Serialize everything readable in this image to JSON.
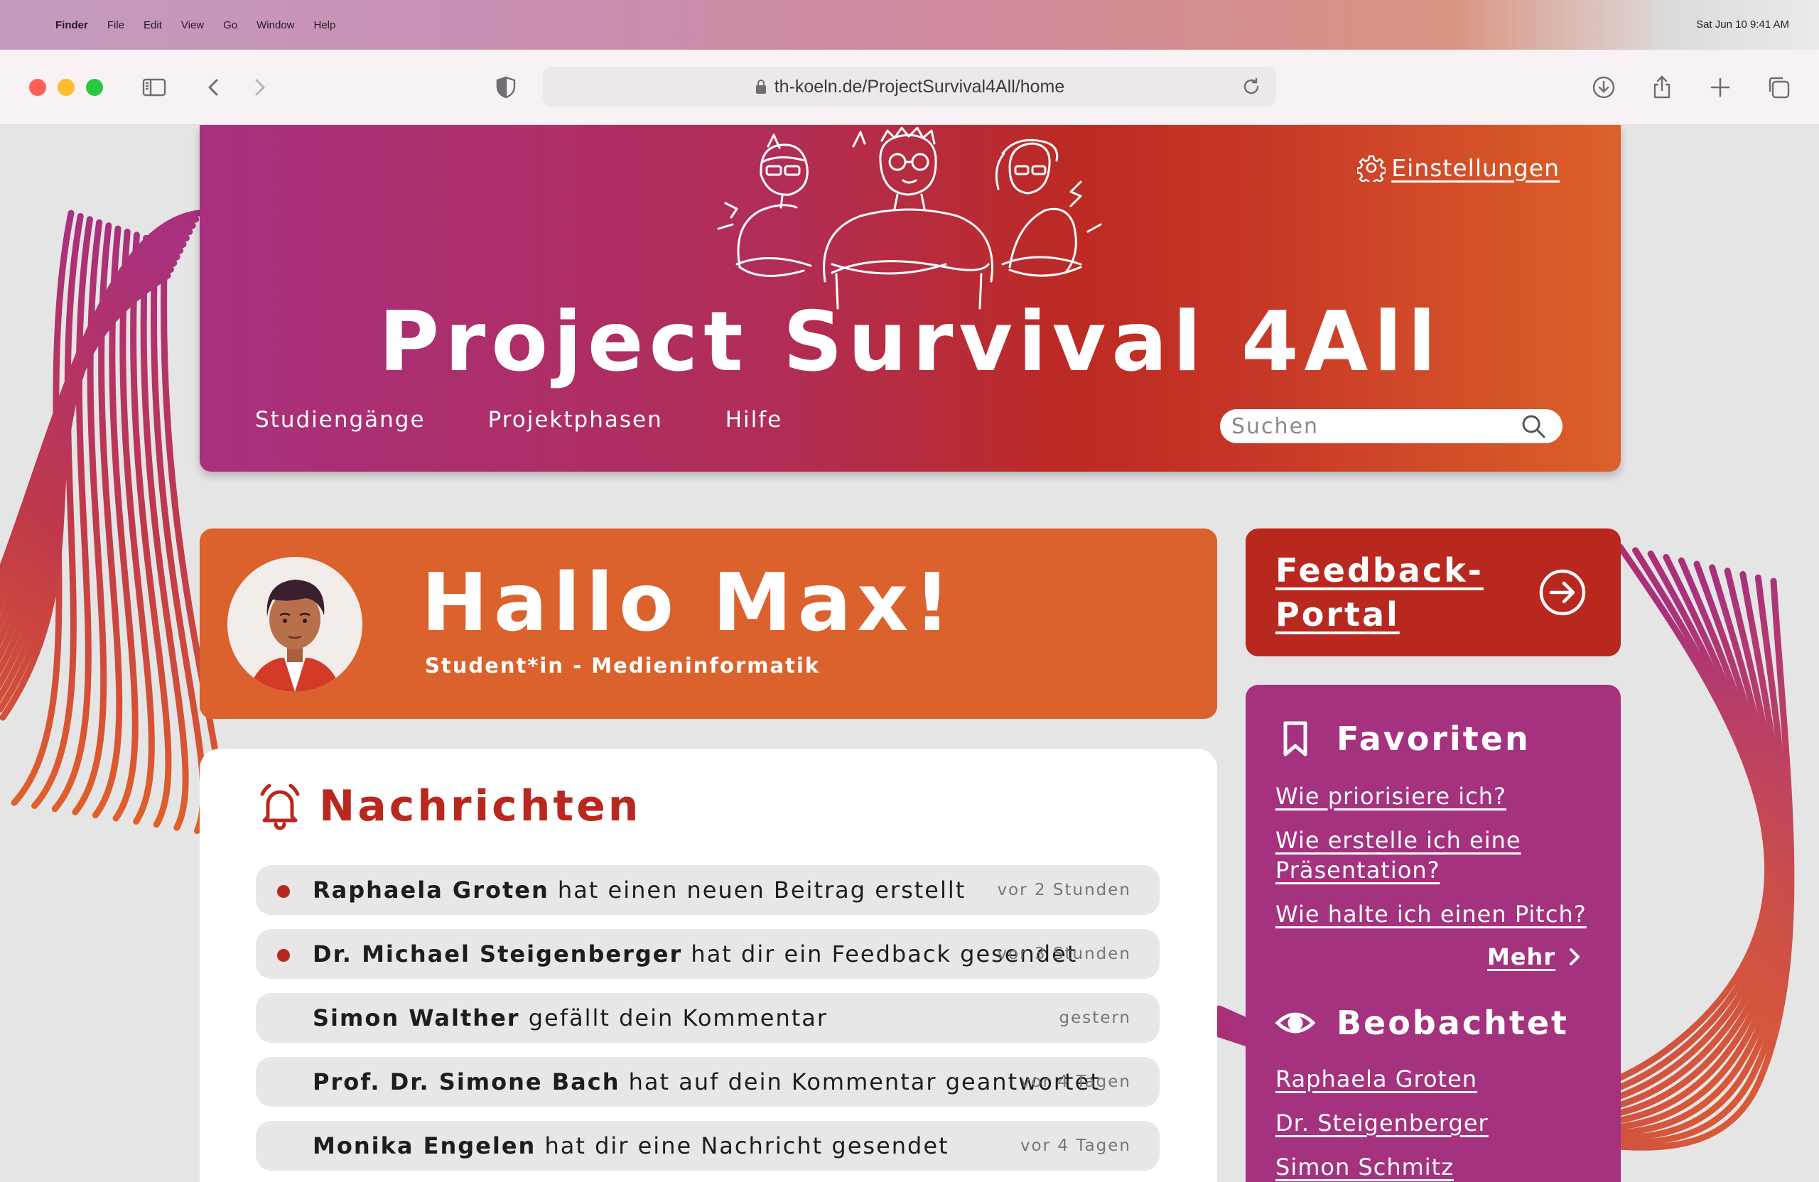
{
  "menubar": {
    "app": "Finder",
    "items": [
      "File",
      "Edit",
      "View",
      "Go",
      "Window",
      "Help"
    ],
    "clock": "Sat Jun 10  9:41 AM"
  },
  "browser": {
    "url": "th-koeln.de/ProjectSurvival4All/home"
  },
  "header": {
    "title": "Project Survival 4All",
    "settings_label": "Einstellungen",
    "nav": [
      "Studiengänge",
      "Projektphasen",
      "Hilfe"
    ],
    "search_placeholder": "Suchen"
  },
  "greeting": {
    "hello": "Hallo Max!",
    "role": "Student*in - Medieninformatik"
  },
  "feedback": {
    "label": "Feedback-Portal"
  },
  "messages": {
    "title": "Nachrichten",
    "items": [
      {
        "name": "Raphaela Groten",
        "text": " hat einen neuen Beitrag erstellt",
        "time": "vor 2 Stunden",
        "unread": true
      },
      {
        "name": "Dr. Michael Steigenberger",
        "text": " hat dir ein Feedback gesendet",
        "time": "vor 3 Stunden",
        "unread": true
      },
      {
        "name": "Simon Walther",
        "text": " gefällt dein Kommentar",
        "time": "gestern",
        "unread": false
      },
      {
        "name": "Prof. Dr. Simone Bach",
        "text": " hat auf dein Kommentar geantwortet",
        "time": "vor 4 Tagen",
        "unread": false
      },
      {
        "name": "Monika Engelen",
        "text": " hat dir eine Nachricht gesendet",
        "time": "vor 4 Tagen",
        "unread": false
      }
    ]
  },
  "favorites": {
    "title": "Favoriten",
    "links": [
      "Wie priorisiere ich?",
      "Wie erstelle ich eine Präsentation?",
      "Wie halte ich einen Pitch?"
    ],
    "more": "Mehr"
  },
  "watched": {
    "title": "Beobachtet",
    "people": [
      "Raphaela Groten",
      "Dr. Steigenberger",
      "Simon Schmitz"
    ]
  },
  "colors": {
    "header_start": "#a8307e",
    "header_red": "#bd2a22",
    "header_end": "#dc6129",
    "greeting_orange": "#db622c",
    "feedback_red": "#b8281f",
    "sidebar_magenta": "#a4327e",
    "unread_dot": "#b8281f"
  },
  "icons": {
    "settings": "gear-icon",
    "search": "magnifier-icon",
    "feedback": "arrow-right-circle-icon",
    "messages": "bell-icon",
    "favorites": "bookmark-icon",
    "watched": "eye-icon"
  }
}
